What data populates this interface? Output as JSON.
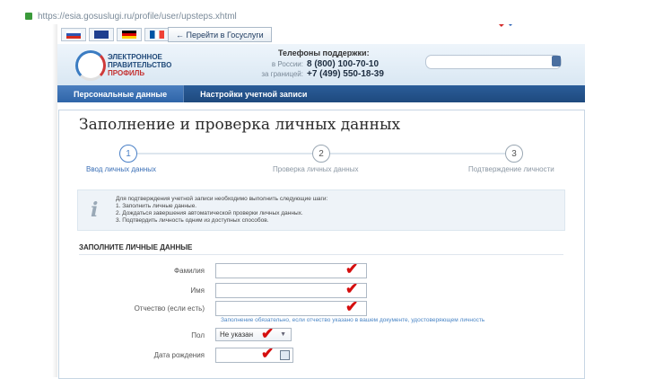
{
  "browser": {
    "url": "https://esia.gosuslugi.ru/profile/user/upsteps.xhtml"
  },
  "top": {
    "languages": [
      "RU",
      "EN",
      "DE",
      "FR"
    ],
    "gosuslugi_link": "← Перейти в Госуслуги"
  },
  "header": {
    "logo_line1": "ЭЛЕКТРОННОЕ",
    "logo_line2": "ПРАВИТЕЛЬСТВО",
    "logo_line3": "ПРОФИЛЬ",
    "support_title": "Телефоны поддержки:",
    "russia_label": "в России:",
    "russia_phone": "8 (800) 100-70-10",
    "abroad_label": "за границей:",
    "abroad_phone": "+7 (499) 550-18-39"
  },
  "tabs": [
    {
      "label": "Персональные данные"
    },
    {
      "label": "Настройки учетной записи"
    }
  ],
  "page": {
    "title": "Заполнение и проверка личных данных"
  },
  "steps": [
    {
      "number": "1",
      "label": "Ввод личных данных"
    },
    {
      "number": "2",
      "label": "Проверка личных данных"
    },
    {
      "number": "3",
      "label": "Подтверждение личности"
    }
  ],
  "info": {
    "intro": "Для подтверждения учетной записи необходимо выполнить следующие шаги:",
    "items": [
      "1. Заполнить личные данные.",
      "2. Дождаться завершения автоматической проверки личных данных.",
      "3. Подтвердить личность одним из доступных способов."
    ]
  },
  "form": {
    "section_title": "ЗАПОЛНИТЕ ЛИЧНЫЕ ДАННЫЕ",
    "surname_label": "Фамилия",
    "name_label": "Имя",
    "patronymic_label": "Отчество (если есть)",
    "patronymic_hint": "Заполнение обязательно, если отчество указано в вашем документе, удостоверяющем личность",
    "gender_label": "Пол",
    "gender_value": "Не указан",
    "birthdate_label": "Дата рождения"
  },
  "colors": {
    "check": "#d50e0e",
    "accent": "#2b5d99",
    "link": "#4b86c6"
  }
}
